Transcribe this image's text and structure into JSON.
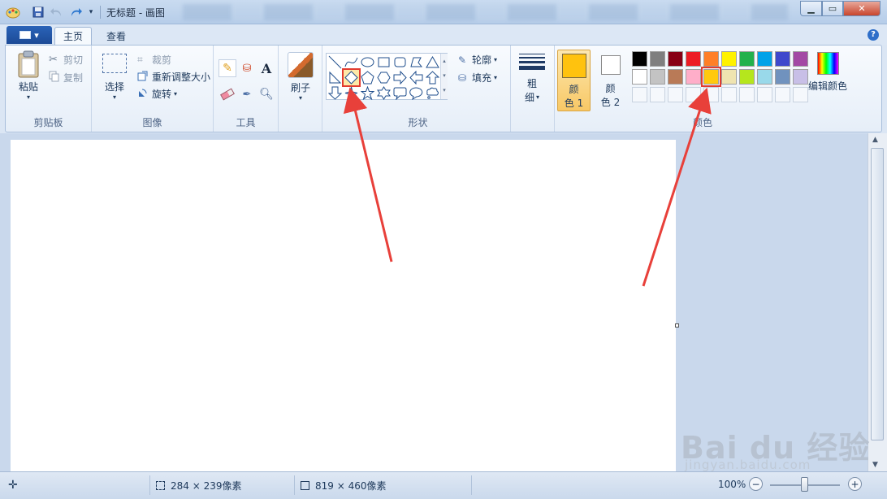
{
  "titlebar": {
    "title": "无标题 - 画图",
    "quick_access": [
      "save-icon",
      "undo-icon",
      "redo-icon",
      "customize-dropdown-icon"
    ],
    "buttons": [
      "minimize",
      "maximize",
      "close"
    ]
  },
  "tabs": {
    "items": [
      {
        "label": "主页",
        "active": true
      },
      {
        "label": "查看",
        "active": false
      }
    ],
    "help": "?"
  },
  "ribbon": {
    "clipboard": {
      "label": "剪贴板",
      "paste": "粘贴",
      "cut": "剪切",
      "copy": "复制"
    },
    "image": {
      "label": "图像",
      "select": "选择",
      "crop": "裁剪",
      "resize": "重新调整大小",
      "rotate": "旋转"
    },
    "tools": {
      "label": "工具"
    },
    "brushes": {
      "label": "刷子"
    },
    "shapes": {
      "label": "形状",
      "outline": "轮廓",
      "fill": "填充",
      "items": [
        "line",
        "curve",
        "oval",
        "rectangle",
        "rounded-rectangle",
        "polygon",
        "triangle",
        "right-triangle",
        "diamond",
        "pentagon",
        "hexagon",
        "right-arrow",
        "left-arrow",
        "up-arrow",
        "down-arrow",
        "four-point-star",
        "five-point-star",
        "six-point-star",
        "rounded-callout",
        "oval-callout",
        "cloud-callout"
      ],
      "selected": "diamond"
    },
    "size": {
      "line1": "粗",
      "line2": "细"
    },
    "colors": {
      "label": "颜色",
      "color1_line1": "颜",
      "color1_line2": "色 1",
      "color2_line1": "颜",
      "color2_line2": "色 2",
      "color1_value": "#ffc20e",
      "color2_value": "#ffffff",
      "edit": "编辑颜色",
      "palette_row1": [
        "#000000",
        "#7f7f7f",
        "#880015",
        "#ed1c24",
        "#ff7f27",
        "#fff200",
        "#22b14c",
        "#00a2e8",
        "#3f48cc",
        "#a349a4"
      ],
      "palette_row2": [
        "#ffffff",
        "#c3c3c3",
        "#b97a57",
        "#ffaec9",
        "#ffc90e",
        "#efe4b0",
        "#b5e61d",
        "#99d9ea",
        "#7092be",
        "#c8bfe7"
      ],
      "selected_swatch": "#ffc90e"
    }
  },
  "status": {
    "cursor": "",
    "selection": "284 × 239像素",
    "canvas_size": "819 × 460像素",
    "zoom": "100%"
  },
  "watermark": {
    "brand": "Bai du 经验",
    "url": "jingyan.baidu.com"
  }
}
